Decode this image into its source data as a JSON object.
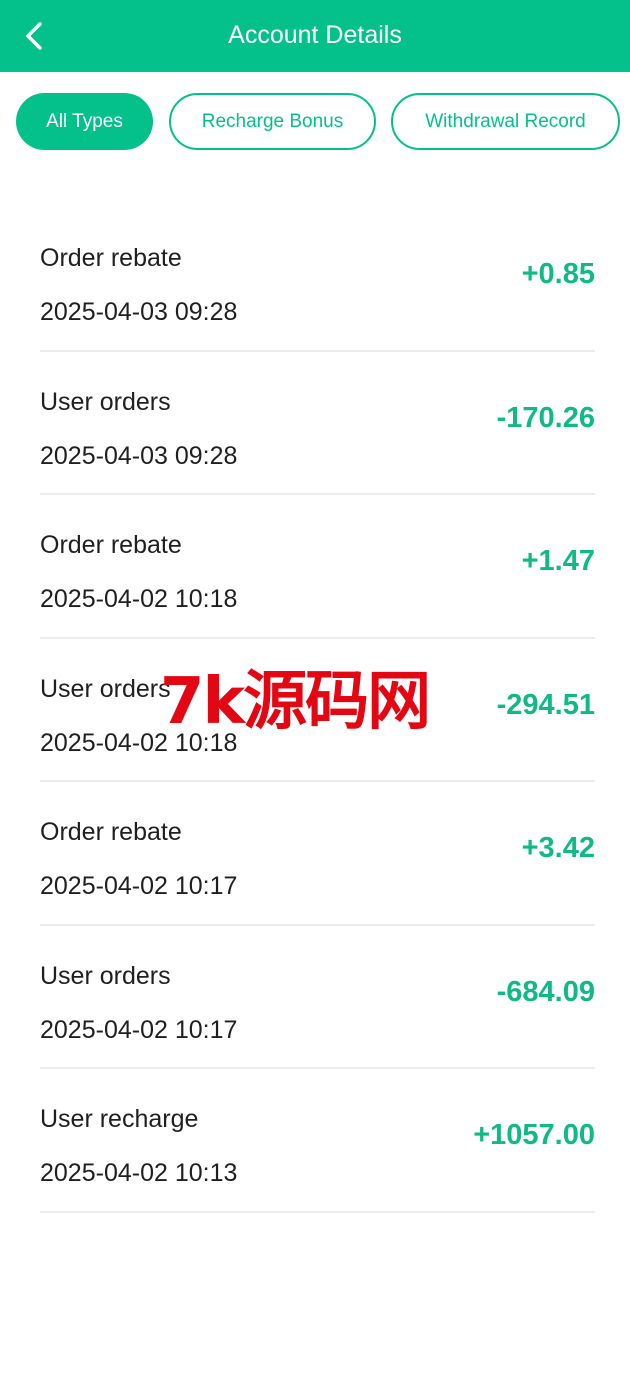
{
  "header": {
    "back_icon": "chevron-left-icon",
    "title": "Account Details"
  },
  "tabs": [
    {
      "label": "All Types",
      "active": true
    },
    {
      "label": "Recharge Bonus",
      "active": false
    },
    {
      "label": "Withdrawal Record",
      "active": false
    }
  ],
  "records": [
    {
      "type": "Order rebate",
      "time": "2025-04-03 09:28",
      "amount": "+0.85"
    },
    {
      "type": "User orders",
      "time": "2025-04-03 09:28",
      "amount": "-170.26"
    },
    {
      "type": "Order rebate",
      "time": "2025-04-02 10:18",
      "amount": "+1.47"
    },
    {
      "type": "User orders",
      "time": "2025-04-02 10:18",
      "amount": "-294.51"
    },
    {
      "type": "Order rebate",
      "time": "2025-04-02 10:17",
      "amount": "+3.42"
    },
    {
      "type": "User orders",
      "time": "2025-04-02 10:17",
      "amount": "-684.09"
    },
    {
      "type": "User recharge",
      "time": "2025-04-02 10:13",
      "amount": "+1057.00"
    }
  ],
  "watermark": "7k源码网",
  "colors": {
    "brand": "#04c18b",
    "amount": "#0fba86",
    "watermark": "#e30613",
    "divider": "#ececec"
  }
}
